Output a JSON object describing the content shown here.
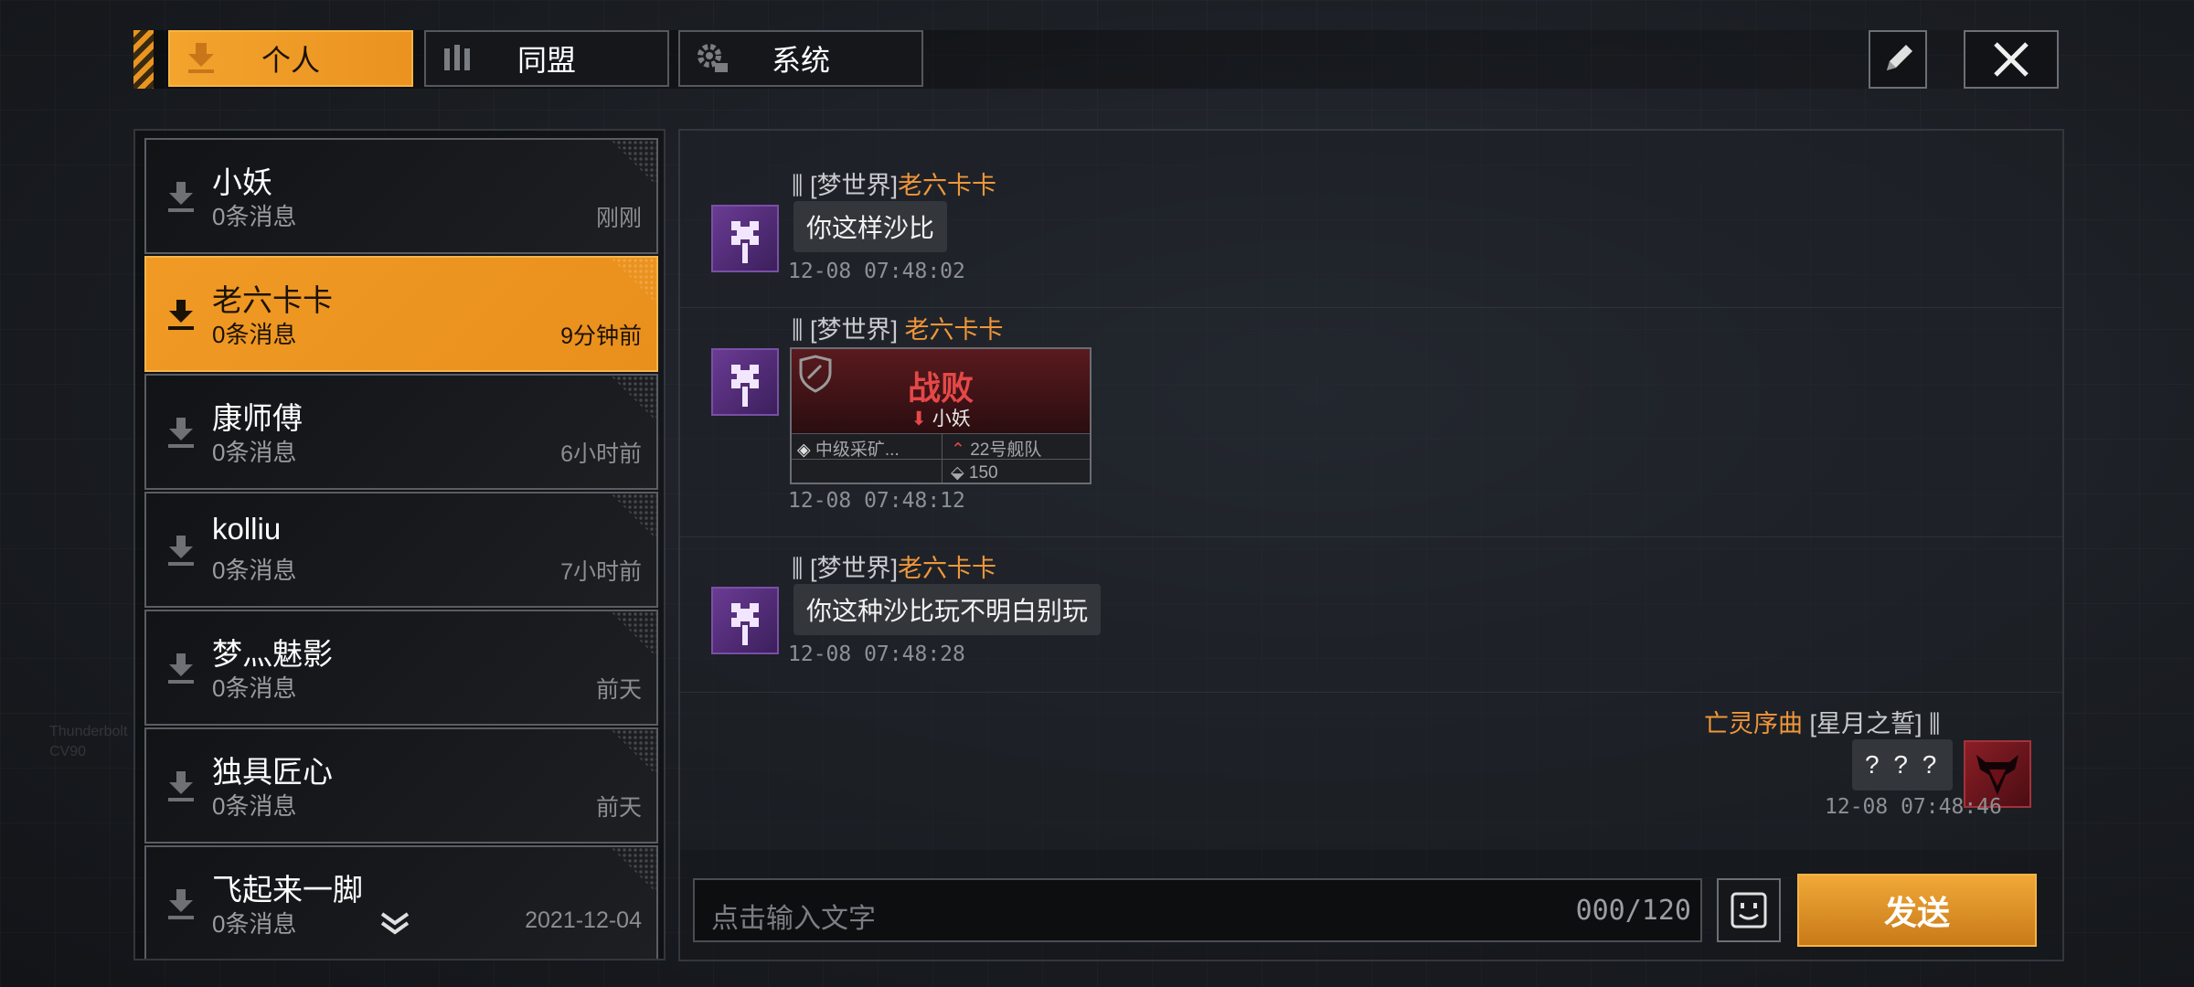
{
  "tabs": [
    {
      "label": "个人",
      "icon": "download-arrow-icon",
      "active": true
    },
    {
      "label": "同盟",
      "icon": "alliance-icon",
      "active": false
    },
    {
      "label": "系统",
      "icon": "gear-icon",
      "active": false
    }
  ],
  "toolbar": {
    "edit_icon": "pencil-icon",
    "close_icon": "close-icon"
  },
  "contacts": [
    {
      "name": "小妖",
      "count": "0条消息",
      "time": "刚刚"
    },
    {
      "name": "老六卡卡",
      "count": "0条消息",
      "time": "9分钟前",
      "active": true
    },
    {
      "name": "康师傅",
      "count": "0条消息",
      "time": "6小时前"
    },
    {
      "name": "kolliu",
      "count": "0条消息",
      "time": "7小时前"
    },
    {
      "name": "梦灬魅影",
      "count": "0条消息",
      "time": "前天"
    },
    {
      "name": "独具匠心",
      "count": "0条消息",
      "time": "前天"
    },
    {
      "name": "飞起来一脚",
      "count": "0条消息",
      "time": "2021-12-04"
    }
  ],
  "messages": [
    {
      "server": "[梦世界]",
      "sender": "老六卡卡",
      "text": "你这样沙比",
      "time": "12-08 07:48:02"
    },
    {
      "server": "[梦世界]",
      "sender": "老六卡卡",
      "time": "12-08 07:48:12",
      "card": {
        "result": "战败",
        "target": "小妖",
        "mission": "中级采矿...",
        "fleet": "22号舰队",
        "amount": "150"
      }
    },
    {
      "server": "[梦世界]",
      "sender": "老六卡卡",
      "text": "你这种沙比玩不明白别玩",
      "time": "12-08 07:48:28"
    },
    {
      "server": "[星月之誓]",
      "sender": "亡灵序曲",
      "text": "? ? ?",
      "time": "12-08 07:48:46",
      "self": true
    }
  ],
  "input": {
    "placeholder": "点击输入文字",
    "counter": "000/120"
  },
  "send_label": "发送",
  "colors": {
    "accent": "#F09A25",
    "sender_name": "#F0963A",
    "defeat": "#E54848"
  },
  "deco": {
    "left": "Thunderbolt",
    "left2": "CV90"
  }
}
